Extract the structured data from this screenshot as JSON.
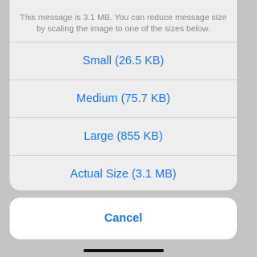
{
  "action_sheet": {
    "message": "This message is 3.1 MB. You can reduce message size by scaling the image to one of the sizes below.",
    "options": [
      {
        "label": "Small (26.5 KB)"
      },
      {
        "label": "Medium (75.7 KB)"
      },
      {
        "label": "Large (855 KB)"
      },
      {
        "label": "Actual Size (3.1 MB)"
      }
    ],
    "cancel_label": "Cancel"
  },
  "colors": {
    "accent": "#1976f0",
    "sheet_background": "#eeeeee",
    "dimmed_background": "#c4c4c4",
    "message_text": "#8a8a8e"
  }
}
